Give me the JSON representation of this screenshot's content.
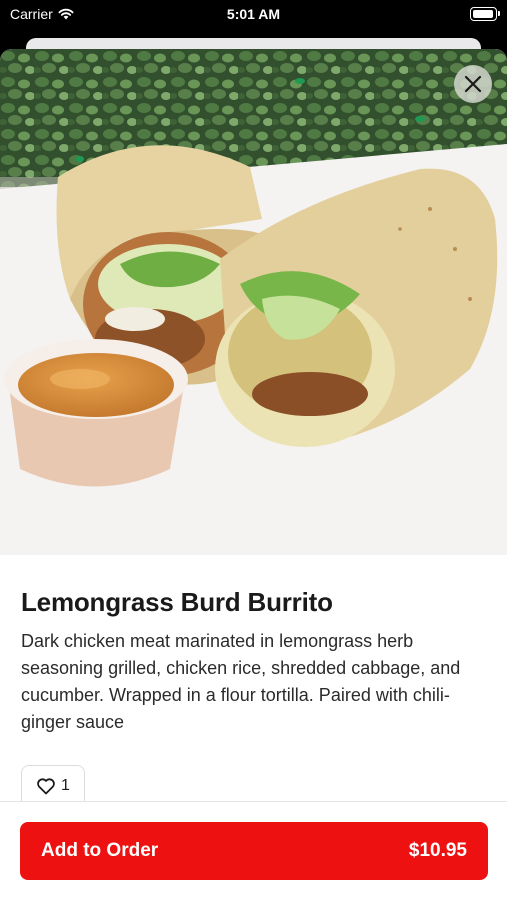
{
  "status_bar": {
    "carrier": "Carrier",
    "time": "5:01 AM"
  },
  "item": {
    "name": "Lemongrass Burd Burrito",
    "description": "Dark chicken meat marinated in lemongrass herb seasoning grilled, chicken rice, shredded cabbage, and cucumber. Wrapped in a flour tortilla. Paired with chili- ginger sauce",
    "like_count": "1",
    "photo_alt": "Burrito cut in half with a cup of chili-ginger sauce"
  },
  "footer": {
    "add_label": "Add to Order",
    "price": "$10.95"
  },
  "icons": {
    "close": "close-icon",
    "heart": "heart-icon",
    "wifi": "wifi-icon",
    "battery": "battery-icon"
  },
  "colors": {
    "accent": "#ee1111"
  }
}
